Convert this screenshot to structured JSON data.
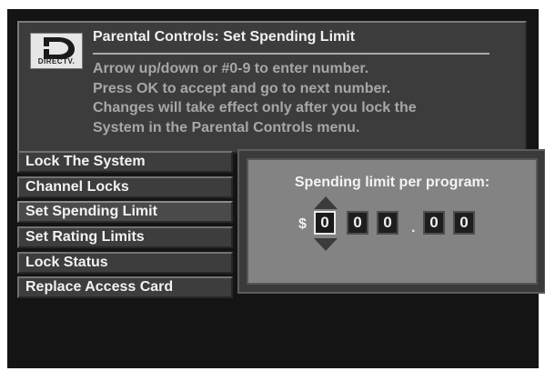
{
  "header": {
    "logo_text": "DIRECTV.",
    "title": "Parental Controls: Set Spending Limit",
    "instructions": [
      "Arrow up/down or #0-9 to enter number.",
      "Press OK to accept and go to next number.",
      "Changes will take effect only after you lock the",
      "System in the Parental Controls menu."
    ]
  },
  "menu": {
    "items": [
      {
        "label": "Lock The System"
      },
      {
        "label": "Channel Locks"
      },
      {
        "label": "Set Spending Limit",
        "selected": true
      },
      {
        "label": "Set Rating Limits"
      },
      {
        "label": "Lock Status"
      },
      {
        "label": "Replace Access Card"
      }
    ]
  },
  "spending": {
    "label": "Spending limit per program:",
    "currency": "$",
    "decimal_separator": ".",
    "digits": [
      "0",
      "0",
      "0",
      "0",
      "0"
    ]
  },
  "icons": {
    "logo": "directv-logo-icon",
    "up": "arrow-up-icon",
    "down": "arrow-down-icon"
  }
}
